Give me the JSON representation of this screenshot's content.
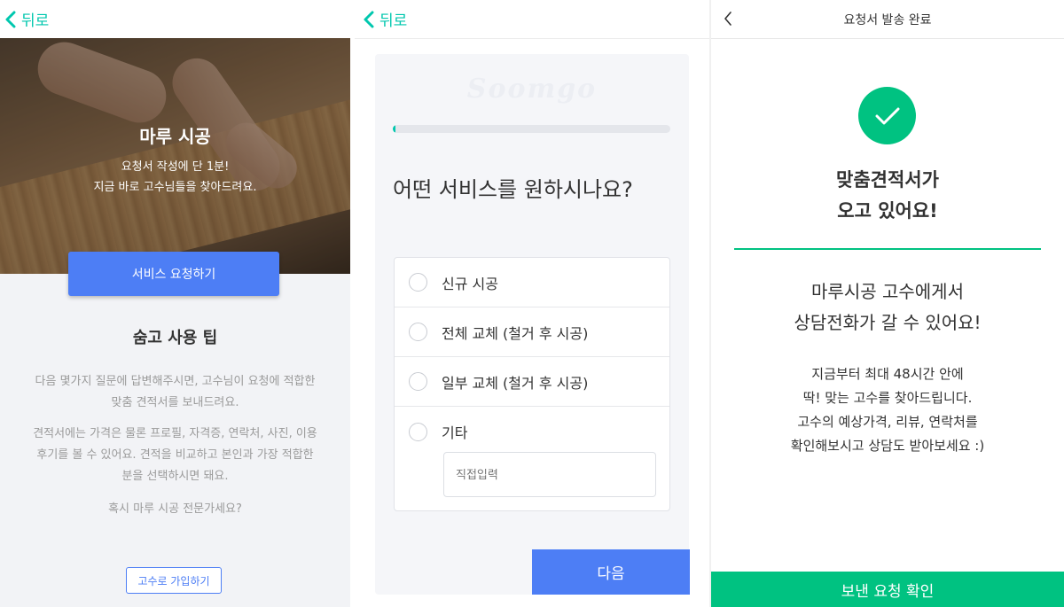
{
  "panel1": {
    "back_label": "뒤로",
    "hero_title": "마루 시공",
    "hero_line1": "요청서 작성에 단 1분!",
    "hero_line2": "지금 바로 고수님들을 찾아드려요.",
    "request_button": "서비스 요청하기",
    "tips_title": "숨고 사용 팁",
    "tip1_line1": "다음 몇가지 질문에 답변해주시면, 고수님이 요청에 적합한",
    "tip1_line2": "맞춤 견적서를 보내드려요.",
    "tip2_line1": "견적서에는 가격은 물론 프로필, 자격증, 연락처, 사진, 이용",
    "tip2_line2": "후기를 볼 수 있어요. 견적을 비교하고 본인과 가장 적합한",
    "tip2_line3": "분을 선택하시면 돼요.",
    "pro_question": "혹시 마루 시공 전문가세요?",
    "join_button": "고수로 가입하기"
  },
  "panel2": {
    "back_label": "뒤로",
    "watermark": "Soomgo",
    "progress_percent": 1,
    "question": "어떤 서비스를 원하시나요?",
    "options": [
      {
        "label": "신규 시공"
      },
      {
        "label": "전체 교체 (철거 후 시공)"
      },
      {
        "label": "일부 교체 (철거 후 시공)"
      },
      {
        "label": "기타"
      }
    ],
    "direct_input_placeholder": "직접입력",
    "next_button": "다음"
  },
  "panel3": {
    "title": "요청서 발송 완료",
    "done_line1": "맞춤견적서가",
    "done_line2": "오고 있어요!",
    "call_line1": "마루시공 고수에게서",
    "call_line2": "상담전화가 갈 수 있어요!",
    "info_line1": "지금부터 최대 48시간 안에",
    "info_line2": "딱! 맞는 고수를 찾아드립니다.",
    "info_line3": "고수의 예상가격, 리뷰, 연락처를",
    "info_line4": "확인해보시고 상담도 받아보세요 :)",
    "confirm_button": "보낸 요청 확인"
  },
  "colors": {
    "accent_teal": "#00c7ae",
    "primary_blue": "#4d7ef5",
    "success_green": "#00c281"
  }
}
